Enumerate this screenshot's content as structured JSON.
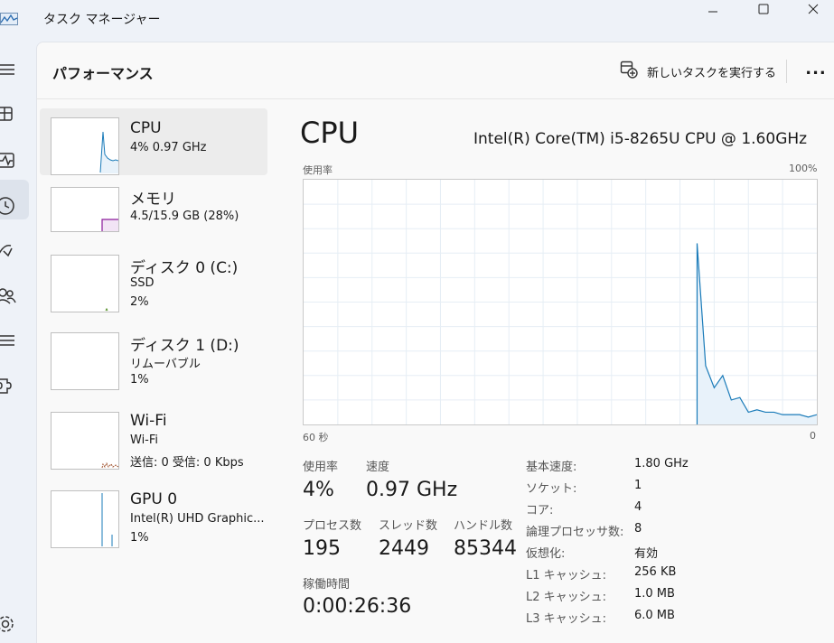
{
  "window": {
    "title": "タスク マネージャー"
  },
  "header": {
    "page_title": "パフォーマンス",
    "run_new_task": "新しいタスクを実行する",
    "more": "..."
  },
  "nav": {
    "icons": [
      "hamburger-icon",
      "processes-icon",
      "performance-icon",
      "app-history-icon",
      "startup-apps-icon",
      "users-icon",
      "details-icon",
      "services-icon",
      "settings-icon"
    ],
    "active": "performance-icon"
  },
  "devices": [
    {
      "name": "CPU",
      "line1": "4% 0.97 GHz",
      "line2": "",
      "selected": true,
      "color": "#1a7bb9"
    },
    {
      "name": "メモリ",
      "line1": "4.5/15.9 GB (28%)",
      "line2": "",
      "selected": false,
      "color": "#8b1a9b"
    },
    {
      "name": "ディスク 0 (C:)",
      "line1": "SSD",
      "line2": "2%",
      "selected": false,
      "color": "#4d8b1f"
    },
    {
      "name": "ディスク 1 (D:)",
      "line1": "リムーバブル",
      "line2": "1%",
      "selected": false,
      "color": "#4d8b1f"
    },
    {
      "name": "Wi-Fi",
      "line1": "Wi-Fi",
      "line2": "送信: 0 受信: 0 Kbps",
      "selected": false,
      "color": "#a0522d"
    },
    {
      "name": "GPU 0",
      "line1": "Intel(R) UHD Graphic...",
      "line2": "1%",
      "selected": false,
      "color": "#1a7bb9"
    }
  ],
  "cpu": {
    "title": "CPU",
    "model": "Intel(R) Core(TM) i5-8265U CPU @ 1.60GHz",
    "graph": {
      "ylabel": "使用率",
      "ymax_label": "100%",
      "x_left_label": "60 秒",
      "x_right_label": "0",
      "color": "#1a7bb9",
      "ylim": [
        0,
        100
      ],
      "x_seconds": [
        60,
        0
      ]
    }
  },
  "chart_data": {
    "type": "area",
    "ylabel": "使用率",
    "ylim": [
      0,
      100
    ],
    "x": [
      60,
      59,
      58,
      57,
      56,
      55,
      54,
      53,
      52,
      51,
      50,
      49,
      48,
      47,
      46,
      45,
      44,
      43,
      42,
      41,
      40,
      39,
      38,
      37,
      36,
      35,
      34,
      33,
      32,
      31,
      30,
      29,
      28,
      27,
      26,
      25,
      24,
      23,
      22,
      21,
      20,
      19,
      18,
      17,
      16,
      15,
      14,
      13,
      12,
      11,
      10,
      9,
      8,
      7,
      6,
      5,
      4,
      3,
      2,
      1,
      0
    ],
    "series": [
      {
        "values": [
          0,
          0,
          0,
          0,
          0,
          0,
          0,
          0,
          0,
          0,
          0,
          0,
          0,
          0,
          0,
          0,
          0,
          0,
          0,
          0,
          0,
          0,
          0,
          0,
          0,
          0,
          0,
          0,
          0,
          0,
          0,
          0,
          0,
          0,
          0,
          0,
          0,
          0,
          0,
          0,
          0,
          0,
          0,
          0,
          0,
          0,
          74,
          24,
          15,
          20,
          10,
          11,
          5,
          6,
          5,
          5,
          4,
          4,
          4,
          3,
          4
        ]
      }
    ]
  },
  "stats": {
    "usage_label": "使用率",
    "usage_value": "4%",
    "speed_label": "速度",
    "speed_value": "0.97 GHz",
    "processes_label": "プロセス数",
    "processes_value": "195",
    "threads_label": "スレッド数",
    "threads_value": "2449",
    "handles_label": "ハンドル数",
    "handles_value": "85344",
    "uptime_label": "稼働時間",
    "uptime_value": "0:00:26:36"
  },
  "info": [
    {
      "label": "基本速度:",
      "value": "1.80 GHz"
    },
    {
      "label": "ソケット:",
      "value": "1"
    },
    {
      "label": "コア:",
      "value": "4"
    },
    {
      "label": "論理プロセッサ数:",
      "value": "8"
    },
    {
      "label": "仮想化:",
      "value": "有効"
    },
    {
      "label": "L1 キャッシュ:",
      "value": "256 KB"
    },
    {
      "label": "L2 キャッシュ:",
      "value": "1.0 MB"
    },
    {
      "label": "L3 キャッシュ:",
      "value": "6.0 MB"
    }
  ]
}
